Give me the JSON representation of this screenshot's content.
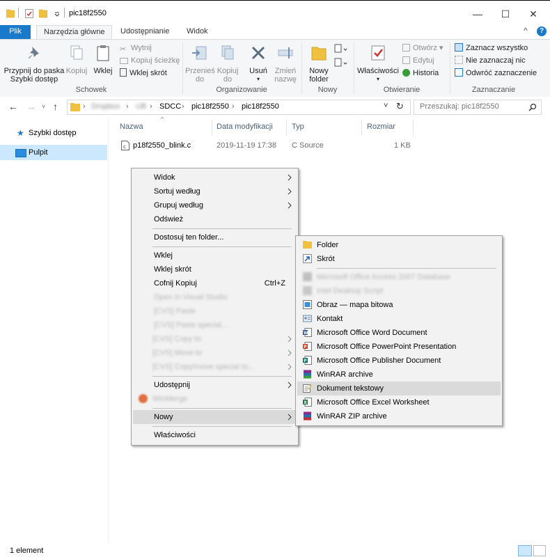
{
  "window": {
    "title": "pic18f2550",
    "controls": [
      "minimize-icon",
      "maximize-icon",
      "close-icon"
    ]
  },
  "tabs": [
    {
      "label": "Plik"
    },
    {
      "label": "Narzędzia główne"
    },
    {
      "label": "Udostępnianie"
    },
    {
      "label": "Widok"
    }
  ],
  "ribbon": {
    "clipboard": {
      "pin_label_1": "Przypnij do paska",
      "pin_label_2": "Szybki dostęp",
      "copy": "Kopiuj",
      "paste": "Wklej",
      "cut": "Wytnij",
      "copy_path": "Kopiuj ścieżkę",
      "paste_shortcut": "Wklej skrót",
      "group": "Schowek"
    },
    "organize": {
      "move_1": "Przenieś",
      "move_2": "do",
      "copy_1": "Kopiuj",
      "copy_2": "do",
      "delete": "Usuń",
      "rename_1": "Zmień",
      "rename_2": "nazwę",
      "group": "Organizowanie"
    },
    "new": {
      "new_folder_1": "Nowy",
      "new_folder_2": "folder",
      "group": "Nowy"
    },
    "open": {
      "properties": "Właściwości",
      "open": "Otwórz",
      "edit": "Edytuj",
      "history": "Historia",
      "group": "Otwieranie"
    },
    "select": {
      "select_all": "Zaznacz wszystko",
      "select_none": "Nie zaznaczaj nic",
      "invert": "Odwróć zaznaczenie",
      "group": "Zaznaczanie"
    }
  },
  "address": {
    "crumbs": [
      "Dropbox",
      "UB",
      "SDCC",
      "pic18f2550",
      "pic18f2550"
    ],
    "search_placeholder": "Przeszukaj: pic18f2550"
  },
  "nav_pane": [
    {
      "label": "Szybki dostęp"
    },
    {
      "label": "Pulpit"
    }
  ],
  "columns": [
    "Nazwa",
    "Data modyfikacji",
    "Typ",
    "Rozmiar"
  ],
  "files": [
    {
      "name": "p18f2550_blink.c",
      "modified": "2019-11-19 17:38",
      "type": "C Source",
      "size": "1 KB"
    }
  ],
  "context_menu": {
    "items": [
      {
        "label": "Widok"
      },
      {
        "label": "Sortuj według"
      },
      {
        "label": "Grupuj według"
      },
      {
        "label": "Odśwież"
      },
      {
        "label": "Dostosuj ten folder..."
      },
      {
        "label": "Wklej"
      },
      {
        "label": "Wklej skrót"
      },
      {
        "label": "Cofnij Kopiuj",
        "shortcut": "Ctrl+Z"
      },
      {
        "label": "Open in Visual Studio"
      },
      {
        "label": "[CVS] Paste"
      },
      {
        "label": "[CVS] Paste special..."
      },
      {
        "label": "[CVS] Copy to"
      },
      {
        "label": "[CVS] Move to"
      },
      {
        "label": "[CVS] Copy/move special to..."
      },
      {
        "label": "Udostępnij"
      },
      {
        "label": "WinMerge"
      },
      {
        "label": "Nowy"
      },
      {
        "label": "Właściwości"
      }
    ]
  },
  "submenu_new": {
    "items": [
      {
        "label": "Folder"
      },
      {
        "label": "Skrót"
      },
      {
        "label": "Microsoft Office Access 2007 Database"
      },
      {
        "label": "Intel Desktop Script"
      },
      {
        "label": "Obraz — mapa bitowa"
      },
      {
        "label": "Kontakt"
      },
      {
        "label": "Microsoft Office Word Document"
      },
      {
        "label": "Microsoft Office PowerPoint Presentation"
      },
      {
        "label": "Microsoft Office Publisher Document"
      },
      {
        "label": "WinRAR archive"
      },
      {
        "label": "Dokument tekstowy"
      },
      {
        "label": "Microsoft Office Excel Worksheet"
      },
      {
        "label": "WinRAR ZIP archive"
      }
    ]
  },
  "status": {
    "count": "1 element"
  },
  "colors": {
    "accent": "#1979ca",
    "ribbon_bg": "#f5f6f7",
    "menu_bg": "#f2f2f2",
    "highlight": "#dadada",
    "nav_selected": "#cce8ff"
  }
}
